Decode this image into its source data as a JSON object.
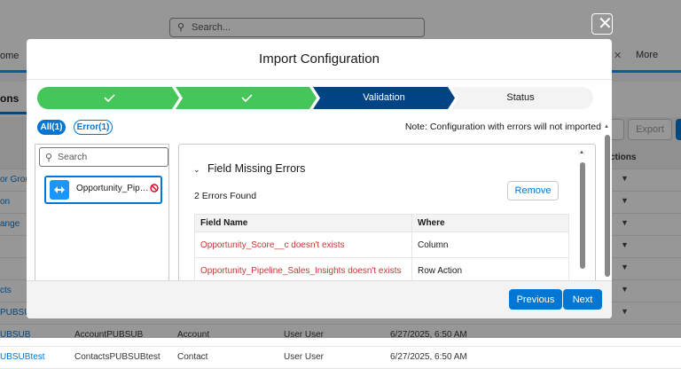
{
  "background": {
    "search_placeholder": "Search...",
    "nav_home": "ome",
    "nav_close": "✕",
    "nav_more": "More",
    "tab_label": "ons",
    "btn_export": "Export",
    "col_actions": "ctions",
    "rows": [
      {
        "c1": "or Grou"
      },
      {
        "c1": "on"
      },
      {
        "c1": "ange"
      },
      {
        "c1": ""
      },
      {
        "c1": ""
      },
      {
        "c1": "cts"
      },
      {
        "c1": "PUBSUB"
      },
      {
        "c1": "UBSUB",
        "c2": "AccountPUBSUB",
        "c3": "Account",
        "c4": "User User",
        "c5": "6/27/2025, 6:50 AM"
      },
      {
        "c1": "UBSUBtest",
        "c2": "ContactsPUBSUBtest",
        "c3": "Contact",
        "c4": "User User",
        "c5": "6/27/2025, 6:50 AM"
      }
    ]
  },
  "modal": {
    "title": "Import Configuration",
    "close_glyph": "✕",
    "path": {
      "steps": [
        {
          "label": "",
          "state": "complete"
        },
        {
          "label": "",
          "state": "complete"
        },
        {
          "label": "Validation",
          "state": "current"
        },
        {
          "label": "Status",
          "state": "incomplete"
        }
      ],
      "colors": {
        "complete": "#45c65a",
        "current": "#014486",
        "incomplete": "#f3f3f3"
      }
    },
    "filters": {
      "all": "All(1)",
      "errors": "Error(1)"
    },
    "note": "Note: Configuration with errors will not imported",
    "left": {
      "search_placeholder": "Search",
      "item_label": "Opportunity_Pipeline_Sales_Insights"
    },
    "right": {
      "section_title": "Field Missing Errors",
      "errors_found": "2 Errors Found",
      "remove_label": "Remove",
      "table": {
        "headers": [
          "Field Name",
          "Where"
        ],
        "rows": [
          [
            "Opportunity_Score__c doesn't exists",
            "Column"
          ],
          [
            "Opportunity_Pipeline_Sales_Insights doesn't exists",
            "Row Action"
          ]
        ]
      }
    },
    "footer": {
      "previous": "Previous",
      "next": "Next"
    }
  }
}
